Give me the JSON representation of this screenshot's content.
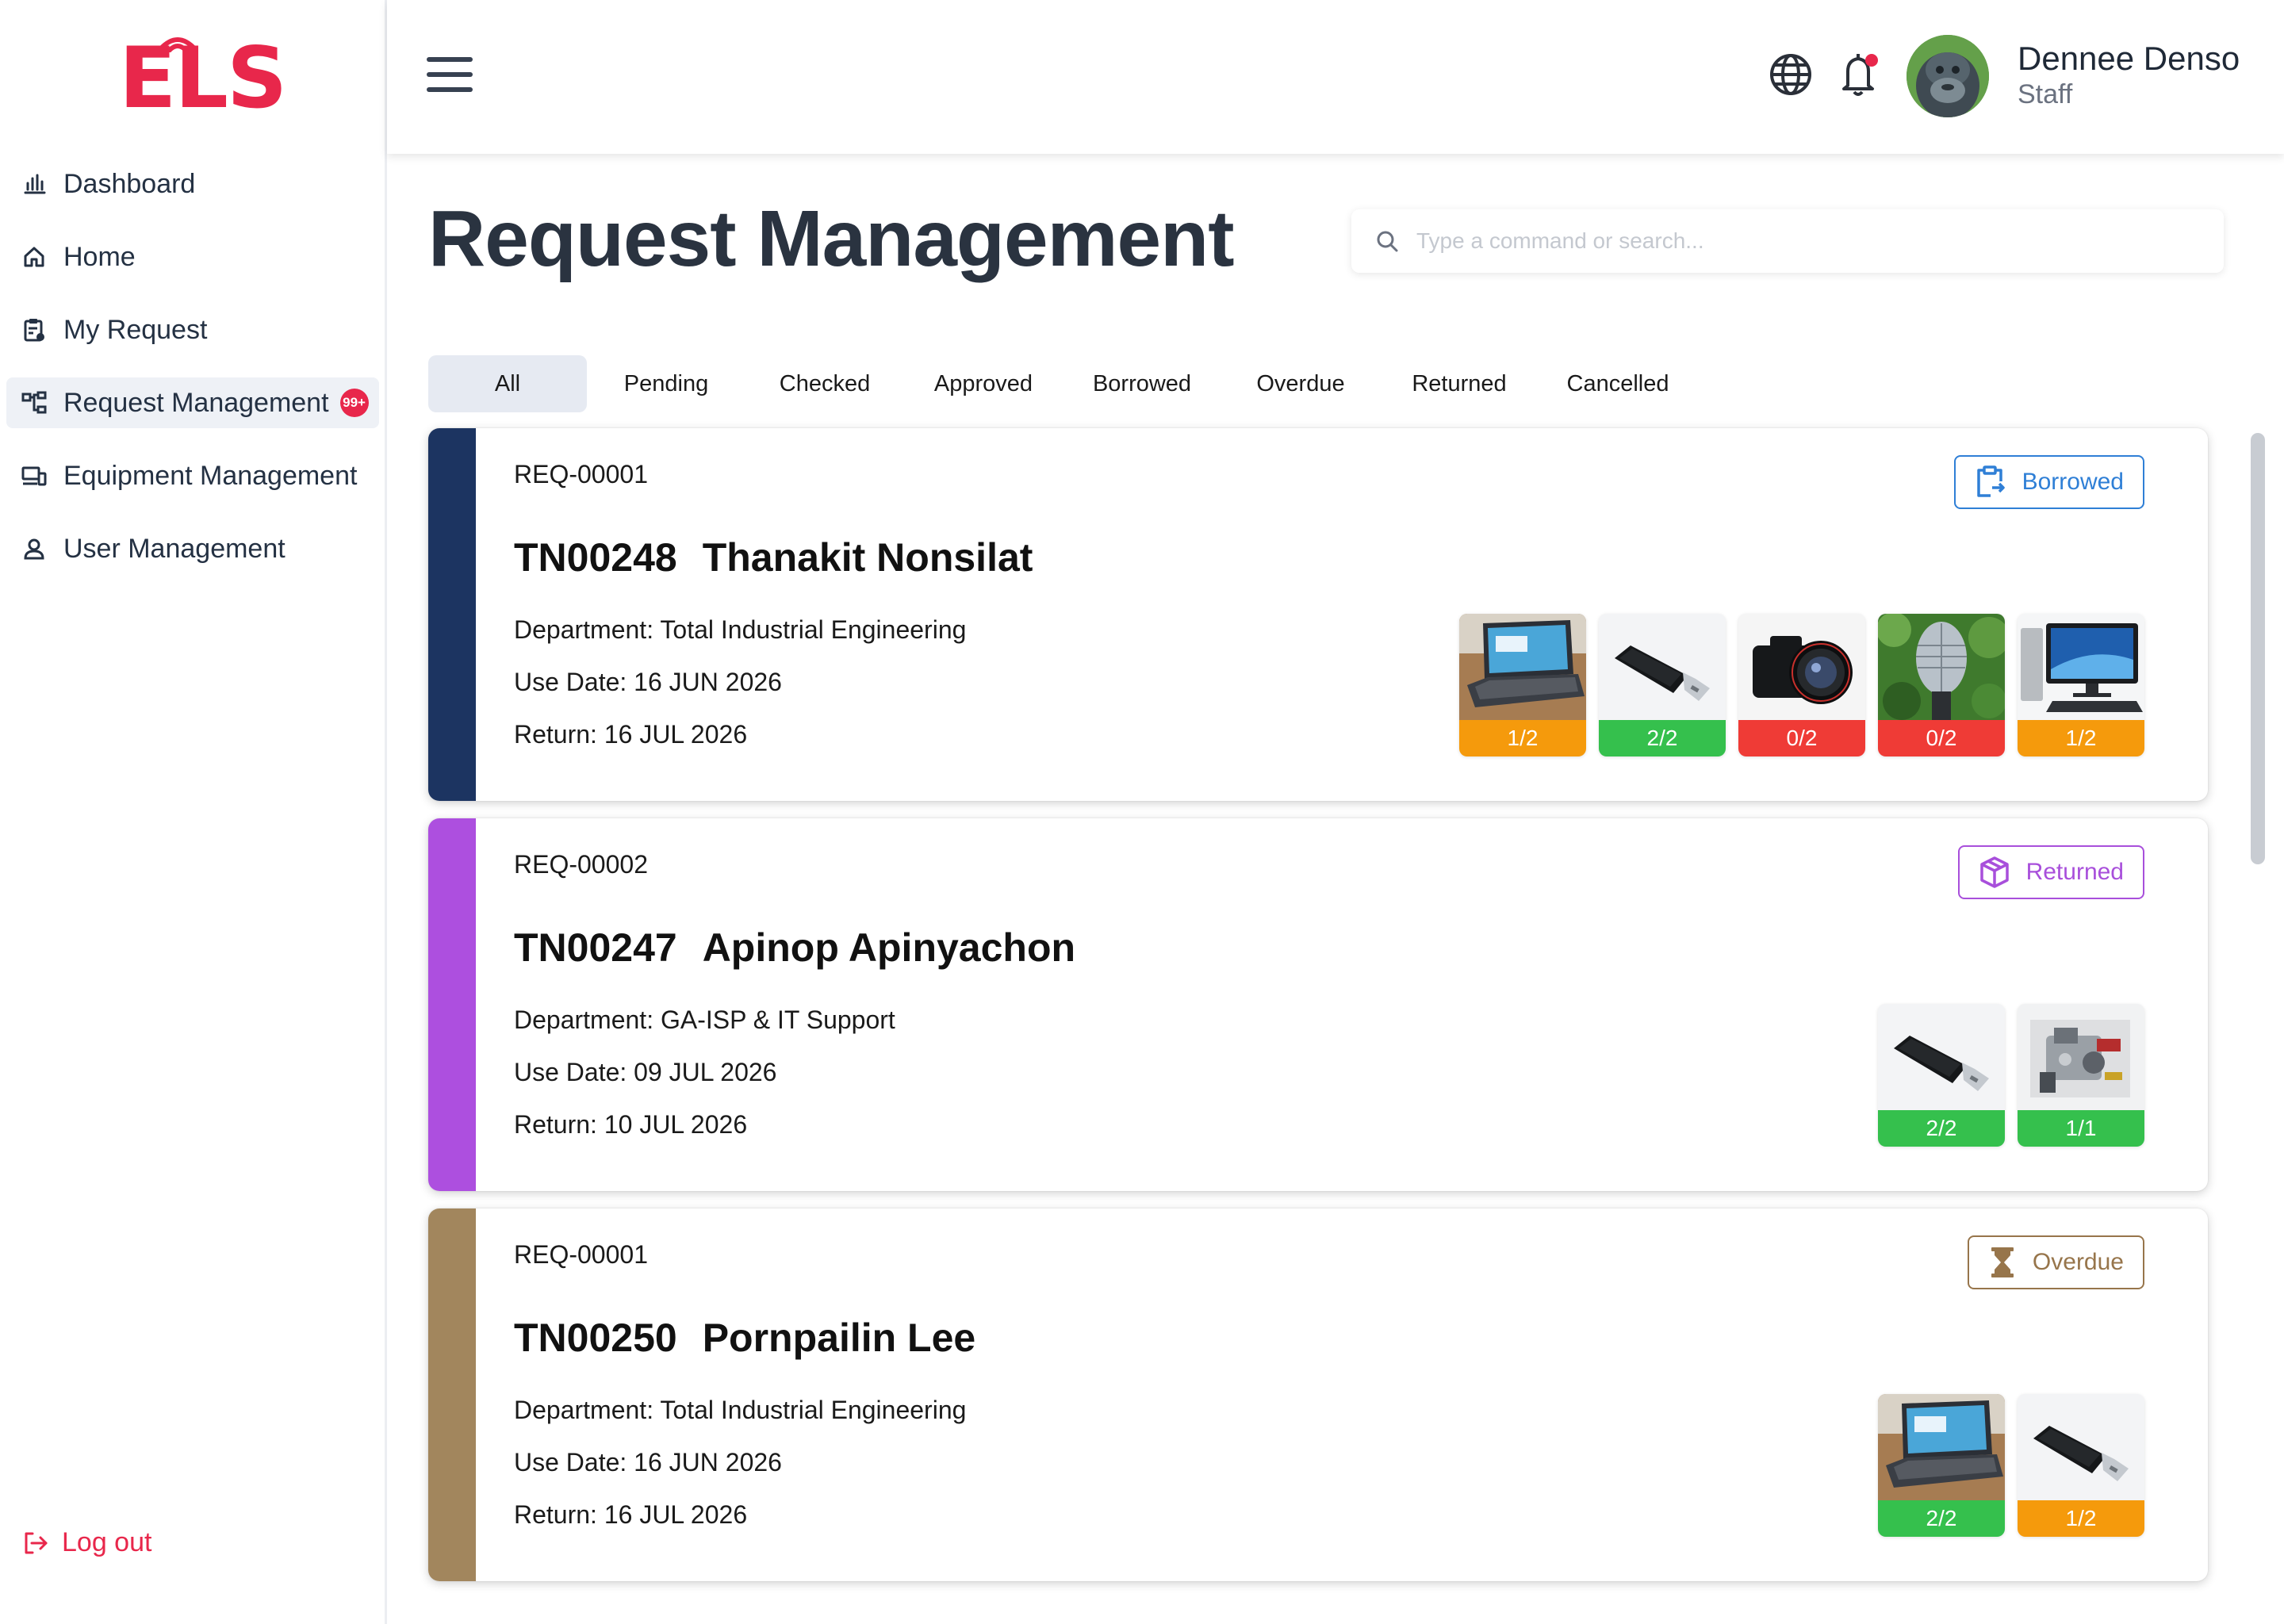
{
  "app": {
    "logo": "ELS"
  },
  "sidebar": {
    "items": [
      {
        "label": "Dashboard",
        "icon": "bar-chart-icon"
      },
      {
        "label": "Home",
        "icon": "home-icon"
      },
      {
        "label": "My Request",
        "icon": "clipboard-icon"
      },
      {
        "label": "Request Management",
        "icon": "hierarchy-icon",
        "badge": "99+",
        "active": true
      },
      {
        "label": "Equipment Management",
        "icon": "devices-icon"
      },
      {
        "label": "User Management",
        "icon": "user-icon"
      }
    ],
    "logout_label": "Log out"
  },
  "header": {
    "user_name": "Dennee Denso",
    "user_role": "Staff",
    "notification_dot_color": "#e8274b"
  },
  "page": {
    "title": "Request Management",
    "search_placeholder": "Type a command or search..."
  },
  "tabs": [
    "All",
    "Pending",
    "Checked",
    "Approved",
    "Borrowed",
    "Overdue",
    "Returned",
    "Cancelled"
  ],
  "active_tab": "All",
  "requests": [
    {
      "req_id": "REQ-00001",
      "emp_code": "TN00248",
      "emp_name": "Thanakit Nonsilat",
      "department": "Department: Total Industrial Engineering",
      "use_date": "Use Date: 16 JUN 2026",
      "return_date": "Return: 16 JUL 2026",
      "status": "Borrowed",
      "status_color": "#2f7fd6",
      "stripe_color": "#1c3461",
      "items": [
        {
          "name": "laptop",
          "count": "1/2",
          "color": "orange"
        },
        {
          "name": "usb-drive",
          "count": "2/2",
          "color": "green"
        },
        {
          "name": "camera",
          "count": "0/2",
          "color": "red"
        },
        {
          "name": "microphone",
          "count": "0/2",
          "color": "red"
        },
        {
          "name": "desktop-computer",
          "count": "1/2",
          "color": "orange"
        }
      ]
    },
    {
      "req_id": "REQ-00002",
      "emp_code": "TN00247",
      "emp_name": "Apinop Apinyachon",
      "department": "Department: GA-ISP & IT Support",
      "use_date": "Use Date: 09 JUL 2026",
      "return_date": "Return: 10 JUL 2026",
      "status": "Returned",
      "status_color": "#a84fdb",
      "stripe_color": "#ad4fdf",
      "items": [
        {
          "name": "usb-drive",
          "count": "2/2",
          "color": "green"
        },
        {
          "name": "machine-part",
          "count": "1/1",
          "color": "green"
        }
      ]
    },
    {
      "req_id": "REQ-00001",
      "emp_code": "TN00250",
      "emp_name": "Pornpailin Lee",
      "department": "Department: Total Industrial Engineering",
      "use_date": "Use Date: 16 JUN 2026",
      "return_date": "Return: 16 JUL 2026",
      "status": "Overdue",
      "status_color": "#97754b",
      "stripe_color": "#a2865d",
      "items": [
        {
          "name": "laptop",
          "count": "2/2",
          "color": "green"
        },
        {
          "name": "usb-drive",
          "count": "1/2",
          "color": "orange"
        }
      ]
    }
  ]
}
